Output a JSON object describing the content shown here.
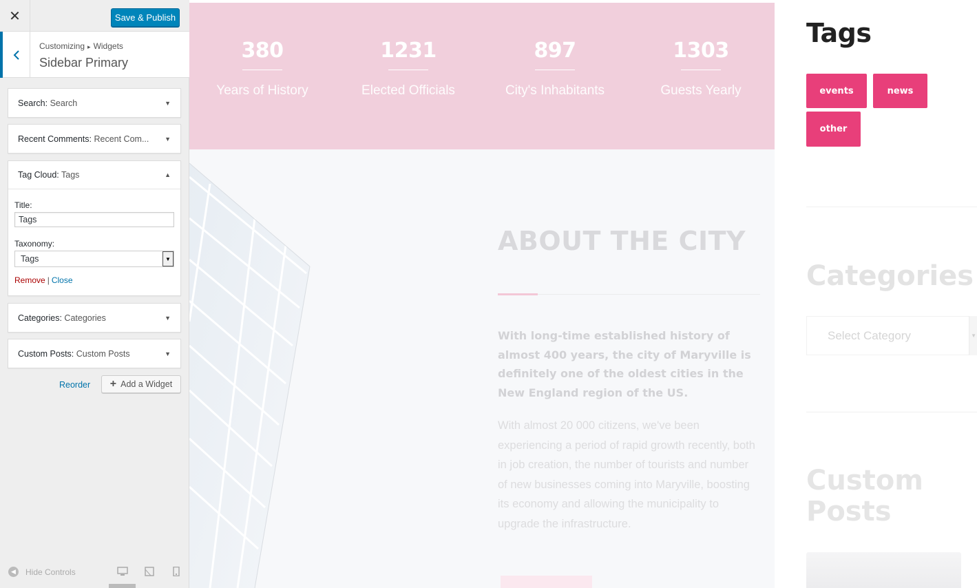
{
  "customizer": {
    "close_icon": "close-icon",
    "publish_label": "Save & Publish",
    "breadcrumb": {
      "first": "Customizing",
      "separator": "▸",
      "second": "Widgets"
    },
    "section_title": "Sidebar Primary",
    "widgets": [
      {
        "type": "Search:",
        "title": "Search",
        "expanded": false
      },
      {
        "type": "Recent Comments:",
        "title": "Recent Com...",
        "expanded": false
      },
      {
        "type": "Tag Cloud:",
        "title": "Tags",
        "expanded": true,
        "form": {
          "title_label": "Title:",
          "title_value": "Tags",
          "taxonomy_label": "Taxonomy:",
          "taxonomy_value": "Tags",
          "remove_label": "Remove",
          "action_separator": "|",
          "close_label": "Close"
        }
      },
      {
        "type": "Categories:",
        "title": "Categories",
        "expanded": false
      },
      {
        "type": "Custom Posts:",
        "title": "Custom Posts",
        "expanded": false
      }
    ],
    "reorder_label": "Reorder",
    "add_widget_label": "Add a Widget",
    "hide_controls_label": "Hide Controls",
    "active_device": "desktop"
  },
  "preview": {
    "stats": [
      {
        "number": "380",
        "label": "Years of History"
      },
      {
        "number": "1231",
        "label": "Elected Officials"
      },
      {
        "number": "897",
        "label": "City's Inhabitants"
      },
      {
        "number": "1303",
        "label": "Guests Yearly"
      }
    ],
    "about": {
      "title": "ABOUT THE CITY",
      "lead": "With long-time established history of almost 400 years, the city of Maryville is definitely one of the oldest cities in the New England region of the US.",
      "body": "With almost 20 000 citizens, we've been experiencing a period of rapid growth recently, both in job creation, the number of tourists and number of new businesses coming into Maryville, boosting its economy and allowing the municipality to upgrade the infrastructure."
    },
    "sidebar": {
      "tags_title": "Tags",
      "tags": [
        "events",
        "news",
        "other"
      ],
      "categories_title": "Categories",
      "category_placeholder": "Select Category",
      "custom_posts_title": "Custom Posts"
    },
    "colors": {
      "accent": "#e83f7a",
      "stats_band": "#f1cfdc",
      "wp_blue": "#0085ba"
    }
  }
}
